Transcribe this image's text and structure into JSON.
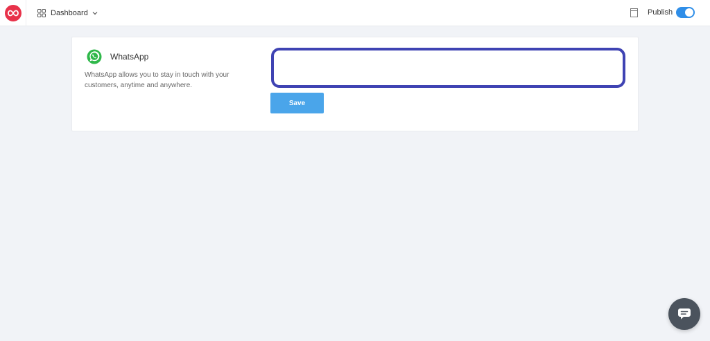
{
  "header": {
    "logo_icon": "infinity-logo-icon",
    "dashboard_label": "Dashboard",
    "publish_label": "Publish",
    "publish_enabled": true,
    "accent_color": "#2f8ee8",
    "logo_color": "#e8324a"
  },
  "integration": {
    "icon": "whatsapp-icon",
    "title": "WhatsApp",
    "description": "WhatsApp allows you to stay in touch with your customers, anytime and anywhere.",
    "input_value": "",
    "input_placeholder": "",
    "save_label": "Save",
    "save_color": "#4aa5ea",
    "input_highlight_color": "#3f43b3"
  },
  "chat_widget": {
    "icon": "chat-bubble-icon"
  }
}
